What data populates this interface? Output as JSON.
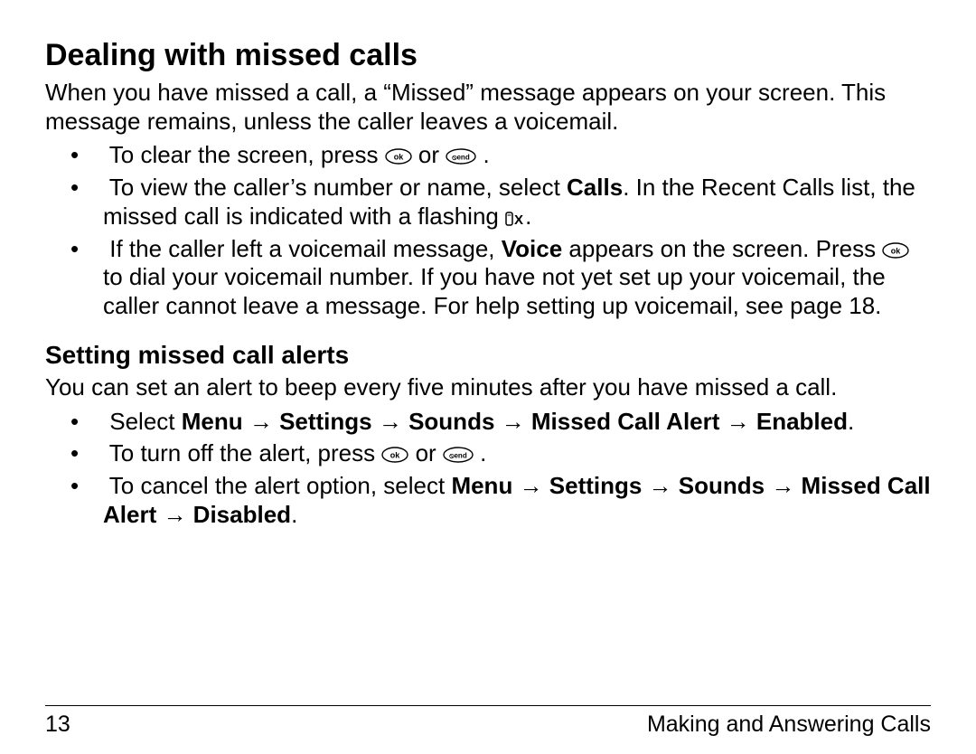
{
  "h1": "Dealing with missed calls",
  "p1": "When you have missed a call, a “Missed” message appears on your screen. This message remains, unless the caller leaves a voicemail.",
  "b1_a": "To clear the screen, press ",
  "b1_b": " or ",
  "b1_c": ".",
  "b2_a": "To view the caller’s number or name, select ",
  "b2_calls": "Calls",
  "b2_b": ". In the Recent Calls list, the missed call is indicated with a flashing ",
  "b2_c": ".",
  "b3_a": "If the caller left a voicemail message, ",
  "b3_voice": "Voice",
  "b3_b": " appears on the screen. Press ",
  "b3_c": " to dial your voicemail number. If you have not yet set up your voicemail, the caller cannot leave a message. For help setting up voicemail, see page 18.",
  "h2": "Setting missed call alerts",
  "p2": "You can set an alert to beep every five minutes after you have missed a call.",
  "c1_a": "Select ",
  "c1_path": "Menu → Settings → Sounds → Missed Call Alert → Enabled",
  "c1_b": ".",
  "c2_a": "To turn off the alert, press ",
  "c2_b": " or ",
  "c2_c": ".",
  "c3_a": "To cancel the alert option, select ",
  "c3_path": "Menu → Settings → Sounds → Missed Call Alert → Disabled",
  "c3_b": ".",
  "footer_page": "13",
  "footer_section": "Making and Answering Calls",
  "icon_missed": "☎x"
}
